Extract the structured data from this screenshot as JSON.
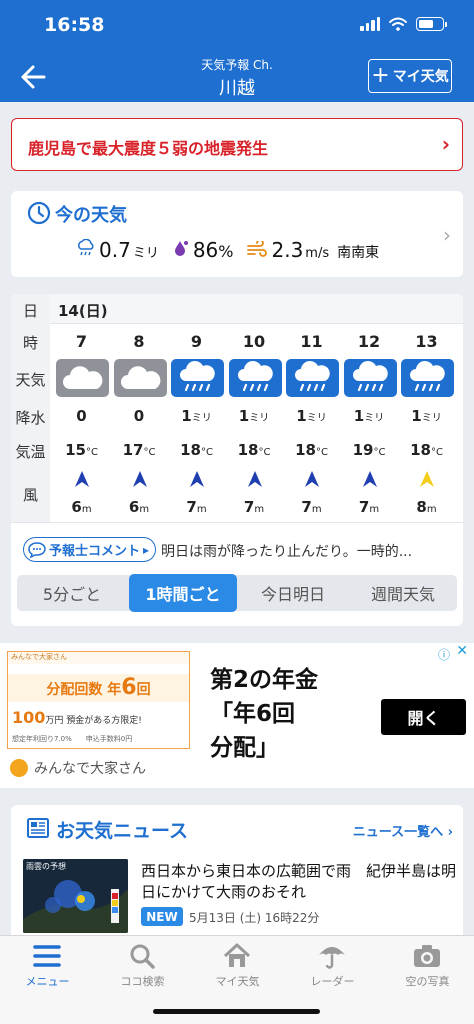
{
  "status": {
    "time": "16:58"
  },
  "nav": {
    "subtitle": "天気予報 Ch.",
    "title": "川越",
    "myweather_label": "マイ天気"
  },
  "alert": {
    "text": "鹿児島で最大震度５弱の地震発生"
  },
  "now": {
    "title": "今の天気",
    "rain_value": "0.7",
    "rain_unit": "ミリ",
    "humidity_value": "86",
    "humidity_unit": "%",
    "wind_value": "2.3",
    "wind_unit": "m/s",
    "wind_dir": "南南東"
  },
  "forecast": {
    "row_labels": {
      "day": "日",
      "hour": "時",
      "weather": "天気",
      "rain": "降水",
      "temp": "気温",
      "wind": "風"
    },
    "date": "14(日)",
    "hours": [
      {
        "hour": "7",
        "weather": "cloudy",
        "rain": "0",
        "rain_unit": "",
        "temp": "15",
        "temp_unit": "°C",
        "wind": "6",
        "wind_unit": "m",
        "arrow_color": "#1f3fb0"
      },
      {
        "hour": "8",
        "weather": "cloudy",
        "rain": "0",
        "rain_unit": "",
        "temp": "17",
        "temp_unit": "°C",
        "wind": "6",
        "wind_unit": "m",
        "arrow_color": "#1f3fb0"
      },
      {
        "hour": "9",
        "weather": "rain",
        "rain": "1",
        "rain_unit": "ミリ",
        "temp": "18",
        "temp_unit": "°C",
        "wind": "7",
        "wind_unit": "m",
        "arrow_color": "#1f3fb0"
      },
      {
        "hour": "10",
        "weather": "rain",
        "rain": "1",
        "rain_unit": "ミリ",
        "temp": "18",
        "temp_unit": "°C",
        "wind": "7",
        "wind_unit": "m",
        "arrow_color": "#1f3fb0"
      },
      {
        "hour": "11",
        "weather": "rain",
        "rain": "1",
        "rain_unit": "ミリ",
        "temp": "18",
        "temp_unit": "°C",
        "wind": "7",
        "wind_unit": "m",
        "arrow_color": "#1f3fb0"
      },
      {
        "hour": "12",
        "weather": "rain",
        "rain": "1",
        "rain_unit": "ミリ",
        "temp": "19",
        "temp_unit": "°C",
        "wind": "7",
        "wind_unit": "m",
        "arrow_color": "#1f3fb0"
      },
      {
        "hour": "13",
        "weather": "rain",
        "rain": "1",
        "rain_unit": "ミリ",
        "temp": "18",
        "temp_unit": "°C",
        "wind": "8",
        "wind_unit": "m",
        "arrow_color": "#f2cd1c"
      }
    ],
    "comment_label": "予報士コメント",
    "comment_text": "明日は雨が降ったり止んだり。一時的...",
    "segments": [
      "5分ごと",
      "1時間ごと",
      "今日明日",
      "週間天気"
    ],
    "active_segment": 1
  },
  "ad": {
    "img_top": "みんなで大家さん",
    "img_big_prefix": "分配回数 年",
    "img_big_num": "6",
    "img_big_suffix": "回",
    "img_mid_prefix": "100",
    "img_mid_suffix": "万円 預金がある方限定!",
    "img_foot": "想定年利回り7.0%　　申込手数料0円",
    "brand": "みんなで大家さん",
    "headline_lines": [
      "第2の年金",
      "「年6回",
      "分配」"
    ],
    "cta": "開く"
  },
  "news": {
    "title": "お天気ニュース",
    "more": "ニュース一覧へ",
    "headline": "西日本から東日本の広範囲で雨　紀伊半島は明日にかけて大雨のおそれ",
    "badge": "NEW",
    "date": "5月13日 (土) 16時22分",
    "thumb_caption": "雨雲の予想"
  },
  "tabs": [
    {
      "label": "メニュー",
      "icon": "menu-icon"
    },
    {
      "label": "ココ検索",
      "icon": "search-icon"
    },
    {
      "label": "マイ天気",
      "icon": "home-icon"
    },
    {
      "label": "レーダー",
      "icon": "umbrella-icon"
    },
    {
      "label": "空の写真",
      "icon": "camera-icon"
    }
  ],
  "colors": {
    "brand": "#1f6fd0",
    "alert": "#d9232a",
    "rain_tile": "#1f6fd0",
    "cloud_tile": "#8f9399"
  }
}
